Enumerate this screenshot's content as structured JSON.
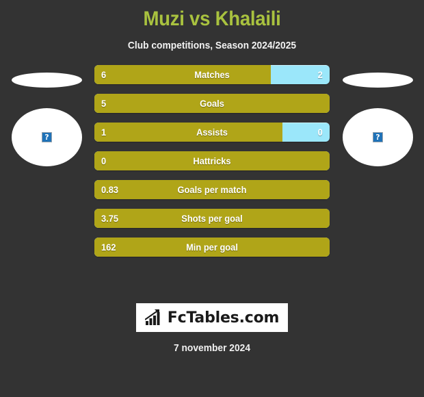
{
  "header": {
    "title": "Muzi vs Khalaili",
    "subtitle": "Club competitions, Season 2024/2025",
    "title_color": "#a9c23f"
  },
  "players": {
    "left": {
      "avatar_icon": "broken-image-icon",
      "avatar_glyph": "?"
    },
    "right": {
      "avatar_icon": "broken-image-icon",
      "avatar_glyph": "?"
    }
  },
  "colors": {
    "background": "#333333",
    "left_bar": "#b0a518",
    "right_bar": "#9be7fa",
    "text": "#ffffff"
  },
  "chart_data": {
    "type": "bar",
    "title": "Muzi vs Khalaili",
    "subtitle": "Club competitions, Season 2024/2025",
    "orientation": "horizontal-diverging",
    "legend": [
      "Muzi",
      "Khalaili"
    ],
    "categories": [
      "Matches",
      "Goals",
      "Assists",
      "Hattricks",
      "Goals per match",
      "Shots per goal",
      "Min per goal"
    ],
    "series": [
      {
        "name": "Muzi",
        "values": [
          6,
          5,
          1,
          0,
          0.83,
          3.75,
          162
        ]
      },
      {
        "name": "Khalaili",
        "values": [
          2,
          0,
          0,
          0,
          0,
          0,
          0
        ]
      }
    ]
  },
  "rows": [
    {
      "label": "Matches",
      "left": "6",
      "right": "2",
      "left_pct": 75,
      "show_right": true
    },
    {
      "label": "Goals",
      "left": "5",
      "right": "",
      "left_pct": 100,
      "show_right": false
    },
    {
      "label": "Assists",
      "left": "1",
      "right": "0",
      "left_pct": 80,
      "show_right": true
    },
    {
      "label": "Hattricks",
      "left": "0",
      "right": "",
      "left_pct": 100,
      "show_right": false
    },
    {
      "label": "Goals per match",
      "left": "0.83",
      "right": "",
      "left_pct": 100,
      "show_right": false
    },
    {
      "label": "Shots per goal",
      "left": "3.75",
      "right": "",
      "left_pct": 100,
      "show_right": false
    },
    {
      "label": "Min per goal",
      "left": "162",
      "right": "",
      "left_pct": 100,
      "show_right": false
    }
  ],
  "footer": {
    "logo_text": "FcTables.com",
    "logo_icon": "bar-chart-growth-icon",
    "date": "7 november 2024"
  }
}
